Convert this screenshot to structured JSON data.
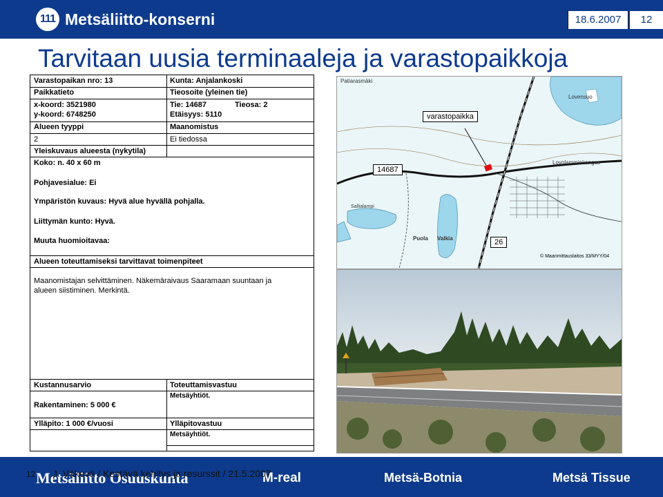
{
  "header": {
    "logo_mark": "111",
    "logo_text": "Metsäliitto-konserni",
    "date": "18.6.2007",
    "page": "12"
  },
  "title": "Tarvitaan uusia terminaaleja ja varastopaikkoja",
  "form": {
    "varastopaikan_nro": "Varastopaikan nro: 13",
    "kunta": "Kunta: Anjalankoski",
    "paikkatieto": "Paikkatieto",
    "tieosoite": "Tieosoite (yleinen tie)",
    "x_koord": "x-koord: 3521980",
    "y_koord": "y-koord: 6748250",
    "tie": "Tie: 14687",
    "tieosa": "Tieosa:  2",
    "etaisyys": "Etäisyys: 5110",
    "alueen_tyyppi": "Alueen tyyppi",
    "alueen_tyyppi_value": "2",
    "maanomistus": "Maanomistus",
    "maanomistus_value": "Ei tiedossa",
    "yleiskuvaus": "Yleiskuvaus alueesta (nykytila)",
    "koko": "Koko: n. 40 x 60 m",
    "pohjavesialue": "Pohjavesialue: Ei",
    "ympariston_kuvaus": "Ympäristön kuvaus: Hyvä alue hyvällä pohjalla.",
    "liittyman_kunto": "Liittymän kunto: Hyvä.",
    "muuta": "Muuta huomioitavaa:",
    "toimenpiteet_heading": "Alueen toteuttamiseksi tarvittavat toimenpiteet",
    "toimenpiteet_line1": "Maanomistajan selvittäminen. Näkemäraivaus Saaramaan suuntaan ja",
    "toimenpiteet_line2": "alueen siistiminen. Merkintä.",
    "kustannusarvio": "Kustannusarvio",
    "toteuttamisvastuu": "Toteuttamisvastuu",
    "toteuttamisvastuu_value": "Metsäyhtiöt.",
    "rakentaminen": "Rakentaminen:  5 000 €",
    "yllapito": "Ylläpito:  1 000 €/vuosi",
    "yllapitovastuu": "Ylläpitovastuu",
    "yllapitovastuu_value": "Metsäyhtiöt."
  },
  "map": {
    "label_varastopaikka": "varastopaikka",
    "road_14687": "14687",
    "road_26": "26",
    "credit": "© Maanmittauslaitos 33/MYY/04",
    "place_patiarasmaki": "Patiarasmäki",
    "place_lovolamminkangas": "Lovolamminkangas",
    "place_lovensuo": "Lovensuo",
    "place_puola": "Puola",
    "place_valkia": "Valkia",
    "place_sallialampi": "Sallialampi"
  },
  "footer": {
    "page": "12",
    "text": "J. Väkevä / Kestävä kehitys ja resurssit /  21.5.2007",
    "logo1": "Metsäliitto Osuuskunta",
    "logo2": "M-real",
    "logo3": "Metsä-Botnia",
    "logo4": "Metsä Tissue"
  },
  "colors": {
    "brand_blue": "#0d3a8c",
    "marker_red": "#e01010"
  }
}
